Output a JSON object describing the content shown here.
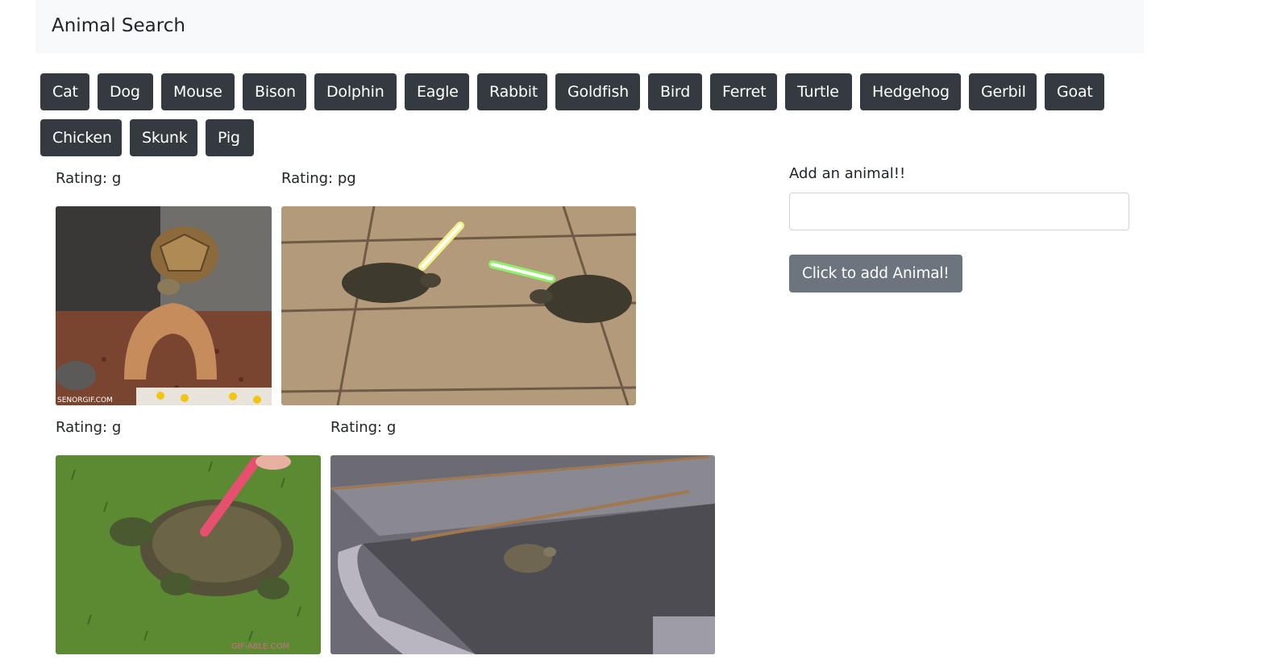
{
  "navbar": {
    "brand": "Animal Search"
  },
  "animal_buttons": [
    "Cat",
    "Dog",
    "Mouse",
    "Bison",
    "Dolphin",
    "Eagle",
    "Rabbit",
    "Goldfish",
    "Bird",
    "Ferret",
    "Turtle",
    "Hedgehog",
    "Gerbil",
    "Goat",
    "Chicken",
    "Skunk",
    "Pig"
  ],
  "results": [
    {
      "rating": "Rating: g",
      "watermark": "SENORGIF.COM"
    },
    {
      "rating": "Rating: pg"
    },
    {
      "rating": "Rating: g",
      "watermark": "GIF-ABLE.COM"
    },
    {
      "rating": "Rating: g"
    }
  ],
  "add_form": {
    "label": "Add an animal!!",
    "input_value": "",
    "input_placeholder": "",
    "submit_label": "Click to add Animal!"
  },
  "colors": {
    "button_dark": "#343a40",
    "button_secondary": "#6c757d",
    "navbar_bg": "#f8f9fa"
  }
}
